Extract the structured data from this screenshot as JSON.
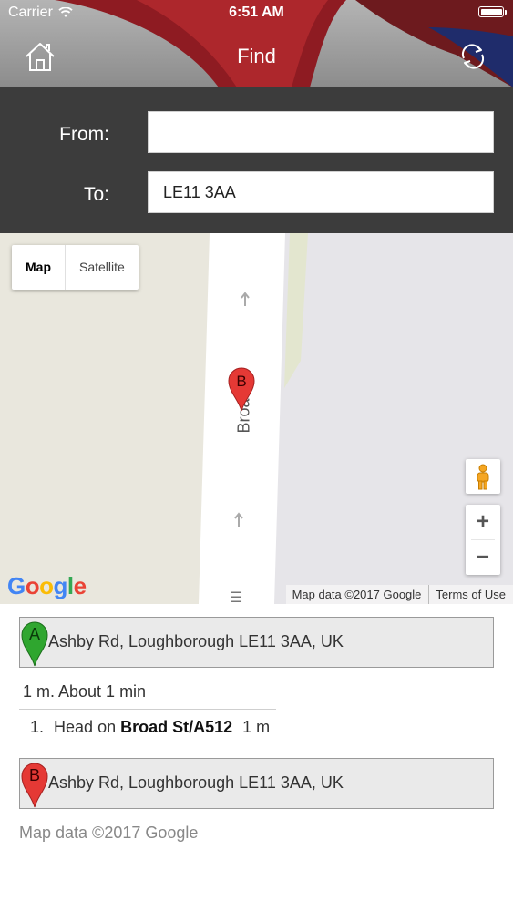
{
  "status_bar": {
    "carrier": "Carrier",
    "time": "6:51 AM"
  },
  "nav": {
    "title": "Find",
    "home_icon": "home-icon",
    "refresh_icon": "refresh-icon"
  },
  "form": {
    "from_label": "From:",
    "from_value": "",
    "to_label": "To:",
    "to_value": "LE11 3AA"
  },
  "map": {
    "map_type_options": [
      "Map",
      "Satellite"
    ],
    "selected_map_type": "Map",
    "road_name": "Broad",
    "marker_label": "B",
    "zoom_in": "+",
    "zoom_out": "−",
    "logo_letters": [
      "G",
      "o",
      "o",
      "g",
      "l",
      "e"
    ],
    "attribution": "Map data ©2017 Google",
    "terms": "Terms of Use"
  },
  "directions": {
    "start": {
      "marker": "A",
      "address": "Ashby Rd, Loughborough LE11 3AA, UK"
    },
    "summary": "1 m. About 1 min",
    "steps": [
      {
        "number": "1.",
        "prefix": "Head on ",
        "road": "Broad St/A512",
        "distance": "1 m"
      }
    ],
    "end": {
      "marker": "B",
      "address": "Ashby Rd, Loughborough LE11 3AA, UK"
    },
    "credit": "Map data ©2017 Google"
  },
  "colors": {
    "form_bg": "#3c3c3c",
    "marker_a": "#2fa62f",
    "marker_b": "#e53935",
    "map_land": "#e8e7e3",
    "road": "#ffffff"
  }
}
